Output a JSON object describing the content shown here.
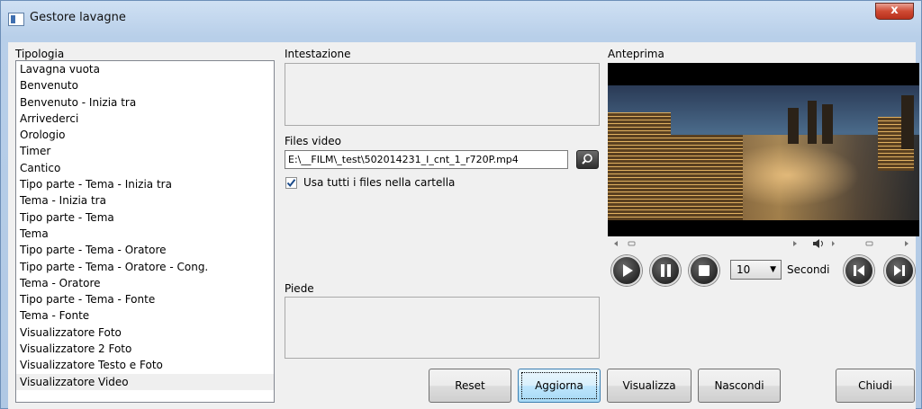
{
  "window": {
    "title": "Gestore lavagne",
    "close_glyph": "x"
  },
  "tipologia": {
    "label": "Tipologia",
    "items": [
      "Lavagna vuota",
      "Benvenuto",
      "Benvenuto - Inizia tra",
      "Arrivederci",
      "Orologio",
      "Timer",
      "Cantico",
      "Tipo parte - Tema - Inizia tra",
      "Tema - Inizia tra",
      "Tipo parte - Tema",
      "Tema",
      "Tipo parte - Tema - Oratore",
      "Tipo parte - Tema - Oratore - Cong.",
      "Tema - Oratore",
      "Tipo parte - Tema - Fonte",
      "Tema - Fonte",
      "Visualizzatore Foto",
      "Visualizzatore 2 Foto",
      "Visualizzatore Testo e Foto",
      "Visualizzatore Video"
    ],
    "selected_index": 19
  },
  "intestazione": {
    "label": "Intestazione",
    "value": ""
  },
  "files_video": {
    "label": "Files video",
    "value": "E:\\__FILM\\_test\\502014231_I_cnt_1_r720P.mp4",
    "browse_icon": "search-icon"
  },
  "usa_tutti": {
    "label": "Usa tutti i files nella cartella",
    "checked": true
  },
  "piede": {
    "label": "Piede",
    "value": ""
  },
  "anteprima": {
    "label": "Anteprima"
  },
  "player": {
    "seconds_value": "10",
    "seconds_label": "Secondi",
    "volume_icon": "speaker-icon"
  },
  "buttons": {
    "reset": "Reset",
    "aggiorna": "Aggiorna",
    "visualizza": "Visualizza",
    "nascondi": "Nascondi",
    "chiudi": "Chiudi"
  }
}
